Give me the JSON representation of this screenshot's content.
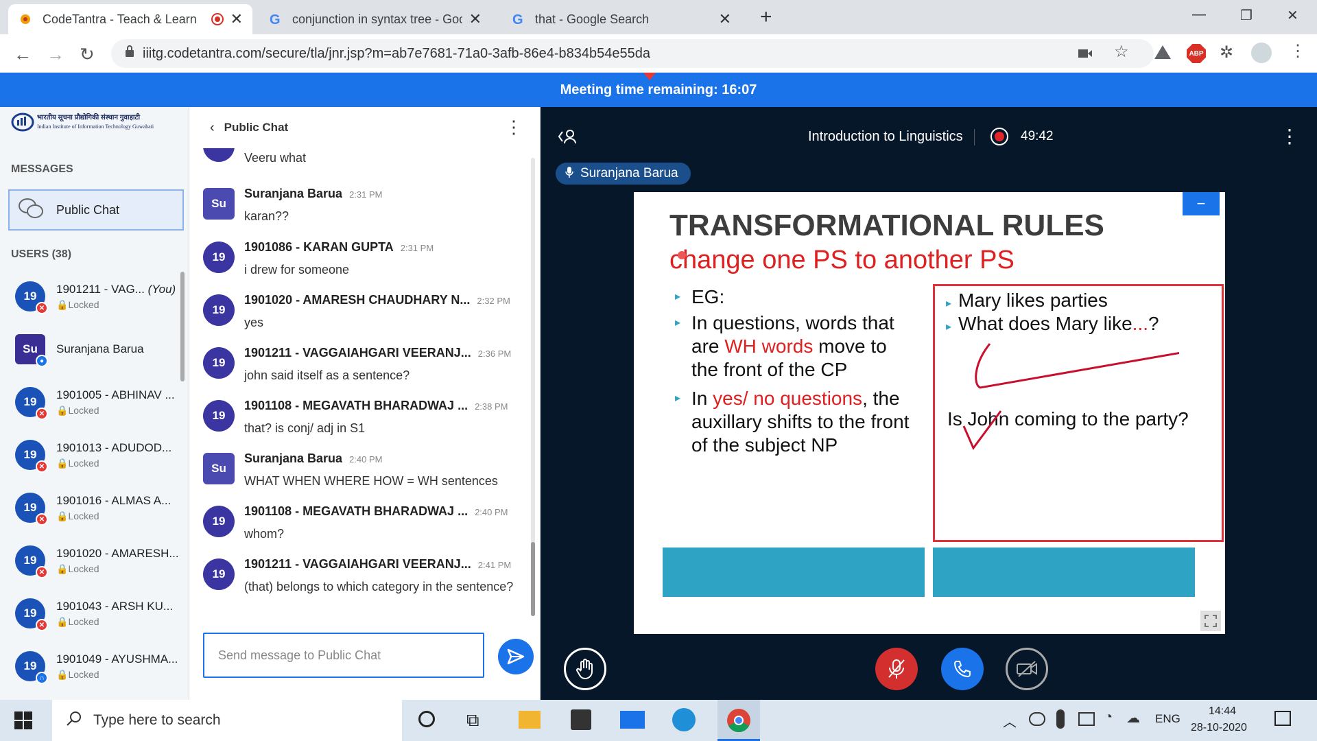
{
  "browser": {
    "tabs": [
      {
        "title": "CodeTantra - Teach & Learn",
        "icon": "codetantra-icon"
      },
      {
        "title": "conjunction in syntax tree - Goog",
        "icon": "google-icon"
      },
      {
        "title": "that - Google Search",
        "icon": "google-icon"
      }
    ],
    "url": "iiitg.codetantra.com/secure/tla/jnr.jsp?m=ab7e7681-71a0-3afb-86e4-b834b54e55da",
    "abp_label": "ABP"
  },
  "meeting": {
    "banner": "Meeting time remaining: 16:07",
    "title": "Introduction to Linguistics",
    "record_time": "49:42",
    "presenter": "Suranjana Barua"
  },
  "sidebar": {
    "institute_line1": "भारतीय सूचना प्रौद्योगिकी संस्थान गुवाहाटी",
    "institute_line2": "Indian Institute of Information Technology Guwahati",
    "messages_heading": "MESSAGES",
    "public_chat_label": "Public Chat",
    "users_heading": "USERS (38)",
    "users": [
      {
        "initials": "19",
        "name": "1901211 - VAG...",
        "you": "(You)",
        "status": "Locked"
      },
      {
        "initials": "Su",
        "name": "Suranjana Barua",
        "status": ""
      },
      {
        "initials": "19",
        "name": "1901005 - ABHINAV ...",
        "status": "Locked"
      },
      {
        "initials": "19",
        "name": "1901013 - ADUDOD...",
        "status": "Locked"
      },
      {
        "initials": "19",
        "name": "1901016 - ALMAS A...",
        "status": "Locked"
      },
      {
        "initials": "19",
        "name": "1901020 - AMARESH...",
        "status": "Locked"
      },
      {
        "initials": "19",
        "name": "1901043 - ARSH KU...",
        "status": "Locked"
      },
      {
        "initials": "19",
        "name": "1901049 - AYUSHMA...",
        "status": "Locked"
      }
    ]
  },
  "chat": {
    "title": "Public Chat",
    "partial_text": "Veeru what",
    "messages": [
      {
        "initials": "Su",
        "who": "Suranjana Barua",
        "time": "2:31 PM",
        "text": "karan??"
      },
      {
        "initials": "19",
        "who": "1901086 - KARAN GUPTA",
        "time": "2:31 PM",
        "text": "i drew for someone"
      },
      {
        "initials": "19",
        "who": "1901020 - AMARESH CHAUDHARY N...",
        "time": "2:32 PM",
        "text": "yes"
      },
      {
        "initials": "19",
        "who": "1901211 - VAGGAIAHGARI VEERANJ...",
        "time": "2:36 PM",
        "text": "john said itself as a sentence?"
      },
      {
        "initials": "19",
        "who": "1901108 - MEGAVATH BHARADWAJ ...",
        "time": "2:38 PM",
        "text": "that? is conj/ adj in S1"
      },
      {
        "initials": "Su",
        "who": "Suranjana Barua",
        "time": "2:40 PM",
        "text": "WHAT WHEN WHERE HOW = WH sentences"
      },
      {
        "initials": "19",
        "who": "1901108 - MEGAVATH BHARADWAJ ...",
        "time": "2:40 PM",
        "text": "whom?"
      },
      {
        "initials": "19",
        "who": "1901211 - VAGGAIAHGARI VEERANJ...",
        "time": "2:41 PM",
        "text": "(that) belongs to which category in the sentence?"
      }
    ],
    "input_placeholder": "Send message to Public Chat"
  },
  "slide": {
    "title": "TRANSFORMATIONAL RULES",
    "subtitle": "change one PS to another PS",
    "left_b1": "EG:",
    "left_b2_pre": "In questions, words that are ",
    "left_b2_hl": "WH words",
    "left_b2_post": " move to the front of the CP",
    "left_b3_pre": "In ",
    "left_b3_hl": "yes/ no questions",
    "left_b3_post": ", the auxillary shifts to the front of the subject NP",
    "right_b1": "Mary likes parties",
    "right_b2_pre": "What does Mary like",
    "right_b2_hl": "...",
    "right_b2_post": "?",
    "right_q": "Is John coming to the party?",
    "minus": "−"
  },
  "taskbar": {
    "search_placeholder": "Type here to search",
    "lang": "ENG",
    "time": "14:44",
    "date": "28-10-2020"
  },
  "colors": {
    "accent": "#1a73e8",
    "slide_red": "#e02020",
    "slide_teal": "#2fa3c4",
    "stage_bg": "#06172a"
  }
}
